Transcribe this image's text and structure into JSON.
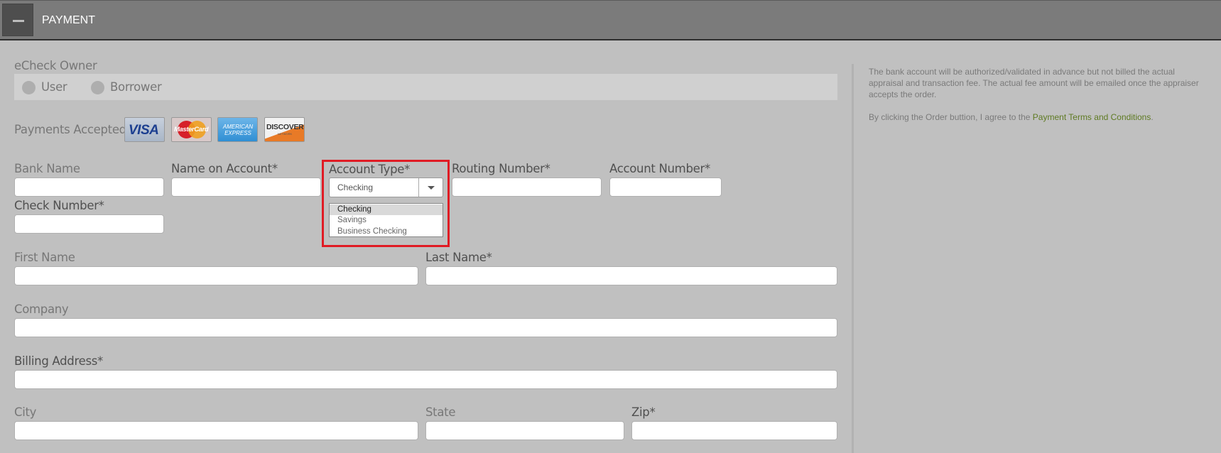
{
  "header": {
    "title": "PAYMENT",
    "collapse_icon": "minus-icon"
  },
  "owner": {
    "label": "eCheck Owner",
    "options": [
      {
        "label": "User",
        "selected": false
      },
      {
        "label": "Borrower",
        "selected": false
      }
    ]
  },
  "payments": {
    "label": "Payments Accepted:",
    "cards": [
      {
        "name": "visa",
        "text": "VISA"
      },
      {
        "name": "mastercard",
        "text": "MasterCard"
      },
      {
        "name": "amex",
        "text": "AMERICAN EXPRESS"
      },
      {
        "name": "discover",
        "text": "DISCOVER",
        "subtext": "NETWORK"
      }
    ]
  },
  "fields": {
    "bank_name": {
      "label": "Bank Name",
      "value": ""
    },
    "name_on_account": {
      "label": "Name on Account*",
      "value": ""
    },
    "account_type": {
      "label": "Account Type*",
      "value": "Checking",
      "options": [
        "Checking",
        "Savings",
        "Business Checking"
      ],
      "highlighted_option": "Checking"
    },
    "routing_number": {
      "label": "Routing Number*",
      "value": ""
    },
    "account_number": {
      "label": "Account Number*",
      "value": ""
    },
    "check_number": {
      "label": "Check Number*",
      "value": ""
    },
    "first_name": {
      "label": "First Name",
      "value": ""
    },
    "last_name": {
      "label": "Last Name*",
      "value": ""
    },
    "company": {
      "label": "Company",
      "value": ""
    },
    "billing_address": {
      "label": "Billing Address*",
      "value": ""
    },
    "city": {
      "label": "City",
      "value": ""
    },
    "state": {
      "label": "State",
      "value": ""
    },
    "zip": {
      "label": "Zip*",
      "value": ""
    }
  },
  "sidebar": {
    "notice": "The bank account will be authorized/validated in advance but not billed the actual appraisal and transaction fee. The actual fee amount will be emailed once the appraiser accepts the order.",
    "agree_prefix": "By clicking the Order buttion, I agree to the ",
    "agree_link": "Payment Terms and Conditions",
    "agree_suffix": "."
  },
  "colors": {
    "highlight": "#e01b24",
    "link": "#5e7a22",
    "header": "#7b7b7b"
  }
}
